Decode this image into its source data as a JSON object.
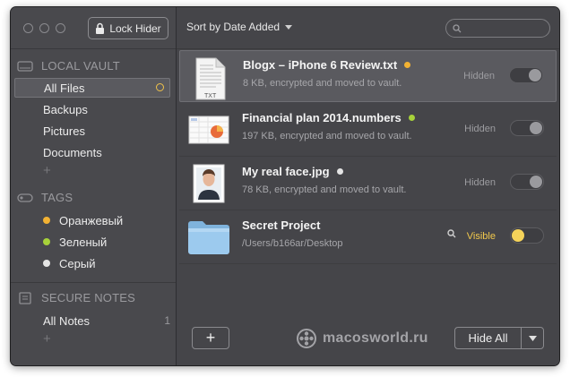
{
  "toolbar": {
    "lock_label": "Lock Hider",
    "sort_label": "Sort by Date Added",
    "search_placeholder": ""
  },
  "sidebar": {
    "local_vault_header": "LOCAL VAULT",
    "vault_items": [
      {
        "label": "All Files",
        "active": true
      },
      {
        "label": "Backups"
      },
      {
        "label": "Pictures"
      },
      {
        "label": "Documents"
      }
    ],
    "tags_header": "TAGS",
    "tags": [
      {
        "label": "Оранжевый",
        "color": "#f2b233"
      },
      {
        "label": "Зеленый",
        "color": "#a7d23a"
      },
      {
        "label": "Серый",
        "color": "#e4e4e4"
      }
    ],
    "secure_notes_header": "SECURE NOTES",
    "notes_items": [
      {
        "label": "All Notes",
        "count": "1"
      }
    ]
  },
  "files": [
    {
      "title": "Blogx – iPhone 6 Review.txt",
      "subtitle": "8 KB, encrypted and moved to vault.",
      "status": "Hidden",
      "tag_color": "#f2b233",
      "toggle": "off",
      "icon": "text-file-icon"
    },
    {
      "title": "Financial plan 2014.numbers",
      "subtitle": "197 KB, encrypted and moved to vault.",
      "status": "Hidden",
      "tag_color": "#a7d23a",
      "toggle": "off",
      "icon": "numbers-file-icon"
    },
    {
      "title": "My real face.jpg",
      "subtitle": "78 KB, encrypted and moved to vault.",
      "status": "Hidden",
      "tag_color": "#e4e4e4",
      "toggle": "off",
      "icon": "photo-file-icon"
    },
    {
      "title": "Secret Project",
      "subtitle": "/Users/b166ar/Desktop",
      "status": "Visible",
      "tag_color": "",
      "toggle": "on",
      "icon": "folder-icon"
    }
  ],
  "bottom": {
    "add_label": "+",
    "hide_all_label": "Hide All",
    "watermark": "macosworld.ru"
  },
  "colors": {
    "accent": "#f2c94c",
    "window_bg": "#46464a"
  }
}
